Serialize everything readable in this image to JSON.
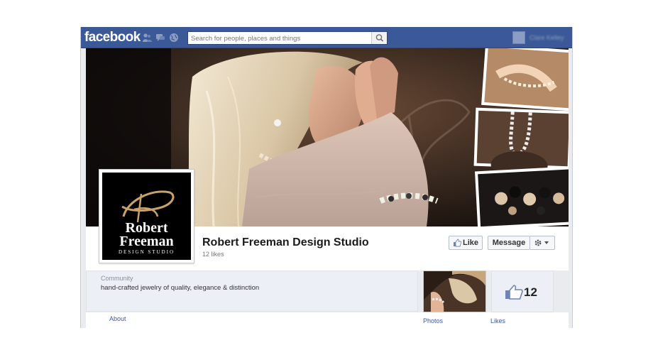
{
  "topbar": {
    "logo_text": "facebook",
    "search_placeholder": "Search for people, places and things",
    "jewels": [
      "friend-requests-icon",
      "messages-icon",
      "notifications-globe-icon"
    ],
    "user_name": "Clare Kelley"
  },
  "page": {
    "title": "Robert Freeman Design Studio",
    "likes_text": "12 likes",
    "logo_line1": "Robert",
    "logo_line2": "Freeman",
    "logo_line3": "DESIGN STUDIO"
  },
  "actions": {
    "like_label": "Like",
    "message_label": "Message"
  },
  "about": {
    "category": "Community",
    "description": "hand-crafted jewelry of quality, elegance & distinction",
    "link_label": "About"
  },
  "apps": {
    "photos_label": "Photos",
    "likes_label": "Likes",
    "likes_count": "12"
  },
  "colors": {
    "brand_blue": "#3b5998",
    "link_blue": "#3b5998",
    "panel_bg": "#eceff5"
  }
}
